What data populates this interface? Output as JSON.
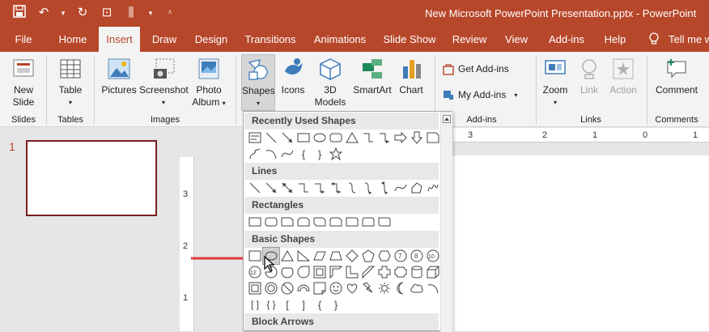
{
  "title": "New Microsoft PowerPoint Presentation.pptx  -  PowerPoint",
  "tabs": [
    "File",
    "Home",
    "Insert",
    "Draw",
    "Design",
    "Transitions",
    "Animations",
    "Slide Show",
    "Review",
    "View",
    "Add-ins",
    "Help",
    "Tell me w"
  ],
  "active_tab": "Insert",
  "ribbon": {
    "new_slide": "New",
    "new_slide2": "Slide",
    "table": "Table",
    "pictures": "Pictures",
    "screenshot": "Screenshot",
    "photo_album": "Photo",
    "photo_album2": "Album",
    "shapes": "Shapes",
    "icons": "Icons",
    "models_3d": "3D",
    "models_3d2": "Models",
    "smartart": "SmartArt",
    "chart": "Chart",
    "get_addins": "Get Add-ins",
    "my_addins": "My Add-ins",
    "zoom": "Zoom",
    "link": "Link",
    "action": "Action",
    "comment": "Comment"
  },
  "groups": {
    "slides": "Slides",
    "tables": "Tables",
    "images": "Images",
    "addins": "Add-ins",
    "links": "Links",
    "comments": "Comments"
  },
  "dropdown": {
    "recent": "Recently Used Shapes",
    "lines": "Lines",
    "rectangles": "Rectangles",
    "basic": "Basic Shapes",
    "block": "Block Arrows"
  },
  "slide_number": "1",
  "ruler_h": [
    "3",
    "2",
    "1",
    "0",
    "1"
  ],
  "ruler_v": [
    "3",
    "2",
    "1"
  ],
  "colors": {
    "accent": "#b7472a",
    "arrow": "#e03a3a"
  }
}
